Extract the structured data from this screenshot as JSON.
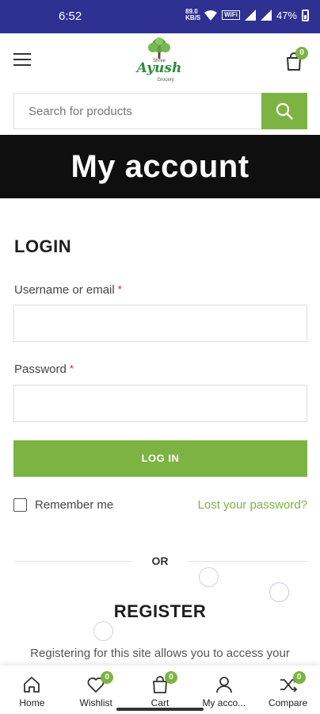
{
  "status_bar": {
    "time": "6:52",
    "data_rate": "89.0 KB/S",
    "wifi_label": "WiFi",
    "battery_percent": "47%"
  },
  "header": {
    "logo": {
      "top_text": "Shree",
      "name": "Ayush",
      "sub_text": "Grocery"
    },
    "cart_count": "0"
  },
  "search": {
    "placeholder": "Search for products"
  },
  "page_title": "My account",
  "login": {
    "title": "LOGIN",
    "username_label": "Username or email",
    "password_label": "Password",
    "required_mark": "*",
    "login_button": "LOG IN",
    "remember_me": "Remember me",
    "lost_password": "Lost your password?"
  },
  "divider_text": "OR",
  "register": {
    "title": "REGISTER",
    "description": "Registering for this site allows you to access your"
  },
  "bottom_nav": {
    "items": [
      {
        "label": "Home",
        "icon": "home-icon"
      },
      {
        "label": "Wishlist",
        "icon": "heart-icon",
        "count": "0"
      },
      {
        "label": "Cart",
        "icon": "cart-icon",
        "count": "0"
      },
      {
        "label": "My acco...",
        "icon": "user-icon"
      },
      {
        "label": "Compare",
        "icon": "shuffle-icon",
        "count": "0"
      }
    ]
  },
  "colors": {
    "status_bar": "#2e3192",
    "accent": "#7cb342",
    "banner": "#0f0f0f",
    "required": "#e01020"
  }
}
